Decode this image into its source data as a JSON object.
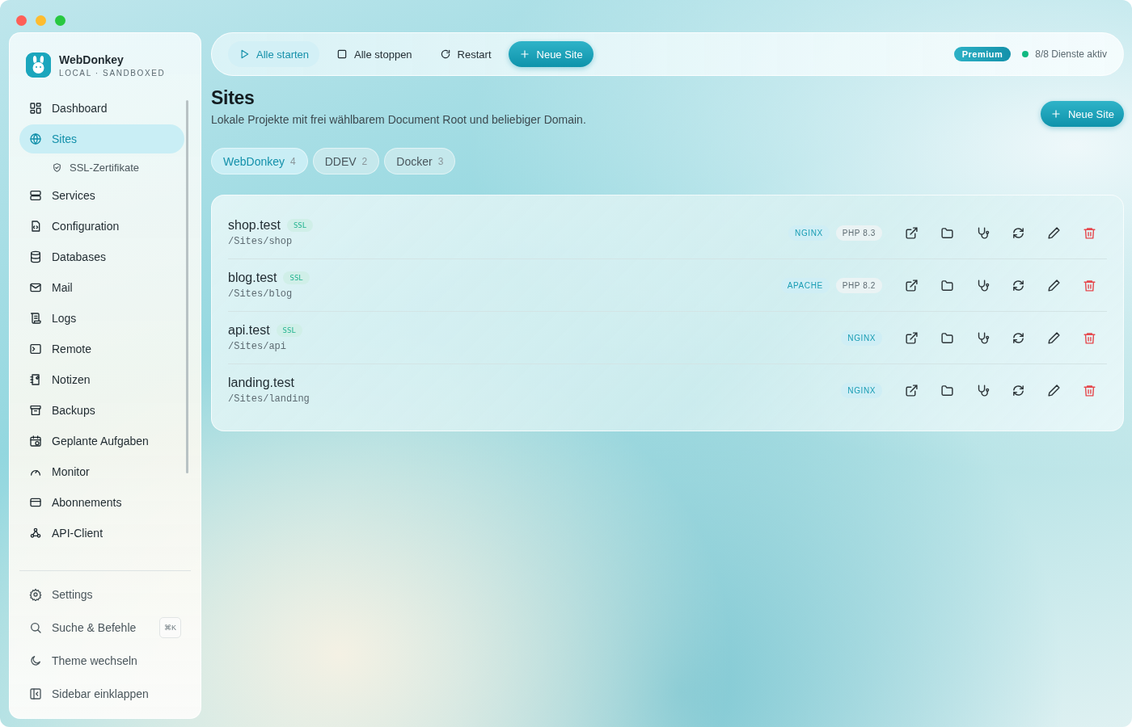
{
  "app": {
    "name": "WebDonkey",
    "subtitle": "LOCAL · SANDBOXED"
  },
  "sidebar": {
    "items": [
      {
        "label": "Dashboard",
        "selected": false
      },
      {
        "label": "Sites",
        "selected": true,
        "children": [
          {
            "label": "SSL-Zertifikate",
            "selected": false
          }
        ]
      },
      {
        "label": "Services",
        "selected": false
      },
      {
        "label": "Configuration",
        "selected": false
      },
      {
        "label": "Databases",
        "selected": false
      },
      {
        "label": "Mail",
        "selected": false
      },
      {
        "label": "Logs",
        "selected": false
      },
      {
        "label": "Remote",
        "selected": false
      },
      {
        "label": "Notizen",
        "selected": false
      },
      {
        "label": "Backups",
        "selected": false
      },
      {
        "label": "Geplante Aufgaben",
        "selected": false
      },
      {
        "label": "Monitor",
        "selected": false
      },
      {
        "label": "Abonnements",
        "selected": false
      },
      {
        "label": "API-Client",
        "selected": false
      }
    ],
    "footer": [
      {
        "label": "Settings"
      },
      {
        "label": "Suche & Befehle",
        "shortcut": "⌘K"
      },
      {
        "label": "Theme wechseln"
      },
      {
        "label": "Sidebar einklappen"
      }
    ]
  },
  "toolbar": {
    "buttons": [
      {
        "label": "Alle starten",
        "kind": "soft"
      },
      {
        "label": "Alle stoppen",
        "kind": "plain"
      },
      {
        "label": "Restart",
        "kind": "plain"
      },
      {
        "label": "Neue Site",
        "kind": "primary"
      }
    ],
    "plan": "Premium",
    "status": "8/8 Dienste aktiv"
  },
  "page": {
    "title": "Sites",
    "description": "Lokale Projekte mit frei wählbarem Document Root und beliebiger Domain.",
    "new_button": "Neue Site"
  },
  "tabs": [
    {
      "label": "WebDonkey",
      "count": "4",
      "selected": true
    },
    {
      "label": "DDEV",
      "count": "2",
      "selected": false
    },
    {
      "label": "Docker",
      "count": "3",
      "selected": false
    }
  ],
  "sites": [
    {
      "name": "shop.test",
      "badge": "SSL",
      "path": "/Sites/shop",
      "server": "NGINX",
      "php": "PHP 8.3"
    },
    {
      "name": "blog.test",
      "badge": "SSL",
      "path": "/Sites/blog",
      "server": "APACHE",
      "php": "PHP 8.2"
    },
    {
      "name": "api.test",
      "badge": "SSL",
      "path": "/Sites/api",
      "server": "NGINX"
    },
    {
      "name": "landing.test",
      "path": "/Sites/landing",
      "server": "NGINX"
    }
  ]
}
